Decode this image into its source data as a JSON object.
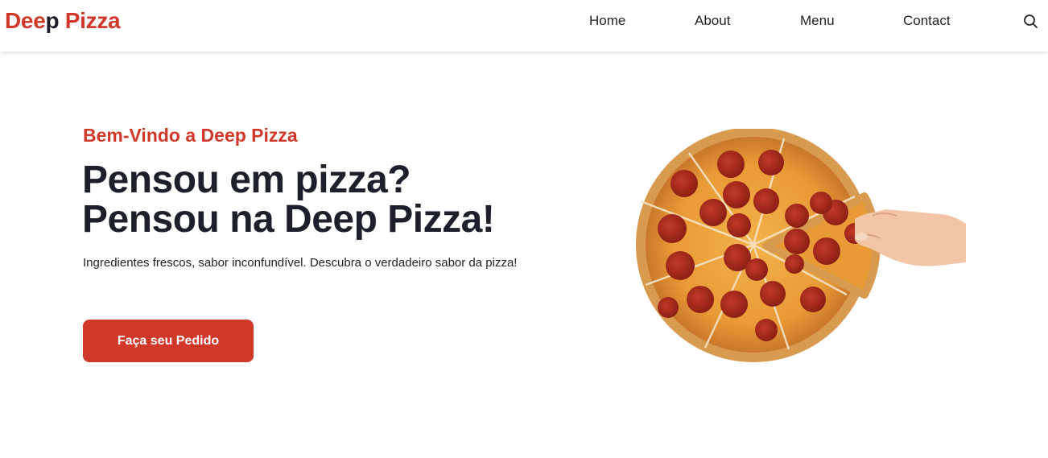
{
  "brand": {
    "part1": "Dee",
    "part2": "p",
    "part3": " Pizza"
  },
  "nav": {
    "home": "Home",
    "about": "About",
    "menu": "Menu",
    "contact": "Contact",
    "search_icon": "search-icon"
  },
  "hero": {
    "subtitle": "Bem-Vindo a Deep Pizza",
    "headline_line1": "Pensou em pizza?",
    "headline_line2": "Pensou na Deep Pizza!",
    "description": "Ingredientes frescos, sabor inconfundível. Descubra o verdadeiro sabor da pizza!",
    "cta_label": "Faça seu Pedido",
    "image": "pepperoni-pizza-with-hand-taking-slice"
  },
  "colors": {
    "accent": "#d0382a",
    "text_dark": "#1d1f2b",
    "background": "#ffffff"
  }
}
